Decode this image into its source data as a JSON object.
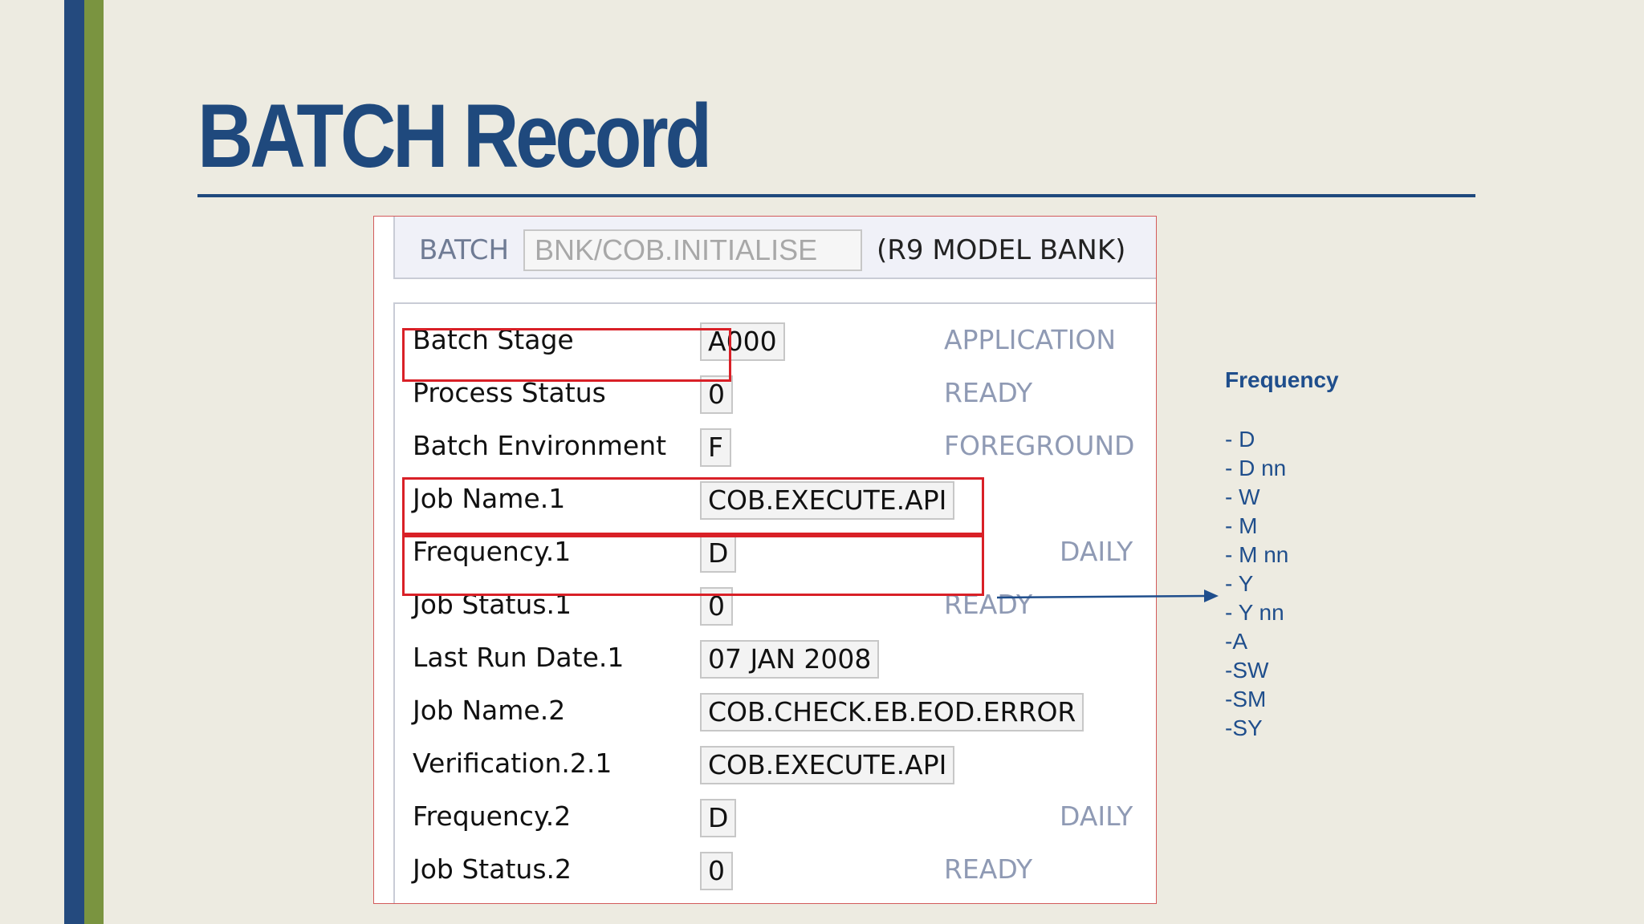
{
  "slide": {
    "title": "BATCH Record"
  },
  "screen": {
    "header": {
      "label": "BATCH",
      "record_id": "BNK/COB.INITIALISE",
      "company": "(R9 MODEL BANK)"
    },
    "fields": [
      {
        "label": "Batch Stage",
        "value": "A000",
        "desc": "APPLICATION"
      },
      {
        "label": "Process Status",
        "value": "0",
        "desc": "READY"
      },
      {
        "label": "Batch Environment",
        "value": "F",
        "desc": "FOREGROUND"
      },
      {
        "label": "Job Name.1",
        "value": "COB.EXECUTE.API",
        "desc": ""
      },
      {
        "label": "Frequency.1",
        "value": "D",
        "desc": "DAILY"
      },
      {
        "label": "Job Status.1",
        "value": "0",
        "desc": "READY"
      },
      {
        "label": "Last Run Date.1",
        "value": "07 JAN 2008",
        "desc": ""
      },
      {
        "label": "Job Name.2",
        "value": "COB.CHECK.EB.EOD.ERROR",
        "desc": ""
      },
      {
        "label": "Verification.2.1",
        "value": "COB.EXECUTE.API",
        "desc": ""
      },
      {
        "label": "Frequency.2",
        "value": "D",
        "desc": "DAILY"
      },
      {
        "label": "Job Status.2",
        "value": "0",
        "desc": "READY"
      }
    ]
  },
  "frequency_note": {
    "title": "Frequency",
    "options": [
      "- D",
      "- D nn",
      "- W",
      "- M",
      "- M nn",
      "- Y",
      "- Y nn",
      "-A",
      "-SW",
      "-SM",
      "-SY"
    ]
  },
  "colors": {
    "title": "#1f497d",
    "highlight": "#d92027",
    "description": "#8f9ab4",
    "note": "#1f4e8c",
    "accent_green": "#7a9440"
  }
}
